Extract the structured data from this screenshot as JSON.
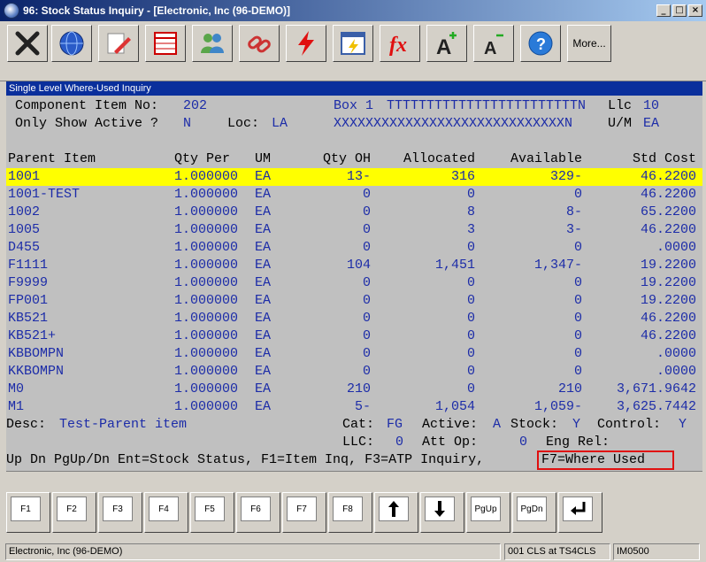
{
  "window": {
    "title": "96: Stock Status Inquiry - [Electronic, Inc (96-DEMO)]"
  },
  "toolbar": {
    "icons": [
      "close-x-icon",
      "globe-icon",
      "edit-pencil-icon",
      "spreadsheet-icon",
      "users-icon",
      "link-chain-icon",
      "lightning-icon",
      "calendar-lightning-icon",
      "function-fx-icon",
      "font-increase-icon",
      "font-decrease-icon",
      "help-icon"
    ],
    "more_label": "More..."
  },
  "panel": {
    "title": "Single Level Where-Used Inquiry"
  },
  "header": {
    "component_label": "Component Item No:",
    "component_value": "202",
    "box_label": "Box 1",
    "box_value": "TTTTTTTTTTTTTTTTTTTTTTTTN",
    "llc_label": "Llc",
    "llc_value": "10",
    "active_label": "Only Show Active ?",
    "active_value": "N",
    "loc_label": "Loc:",
    "loc_value": "LA",
    "desc_value": "XXXXXXXXXXXXXXXXXXXXXXXXXXXXXN",
    "um_label": "U/M",
    "um_value": "EA"
  },
  "table": {
    "columns": [
      "Parent Item",
      "Qty Per",
      "UM",
      "Qty OH",
      "Allocated",
      "Available",
      "Std Cost"
    ],
    "rows": [
      [
        "1001",
        "1.000000",
        "EA",
        "13-",
        "316",
        "329-",
        "46.2200"
      ],
      [
        "1001-TEST",
        "1.000000",
        "EA",
        "0",
        "0",
        "0",
        "46.2200"
      ],
      [
        "1002",
        "1.000000",
        "EA",
        "0",
        "8",
        "8-",
        "65.2200"
      ],
      [
        "1005",
        "1.000000",
        "EA",
        "0",
        "3",
        "3-",
        "46.2200"
      ],
      [
        "D455",
        "1.000000",
        "EA",
        "0",
        "0",
        "0",
        ".0000"
      ],
      [
        "F1111",
        "1.000000",
        "EA",
        "104",
        "1,451",
        "1,347-",
        "19.2200"
      ],
      [
        "F9999",
        "1.000000",
        "EA",
        "0",
        "0",
        "0",
        "19.2200"
      ],
      [
        "FP001",
        "1.000000",
        "EA",
        "0",
        "0",
        "0",
        "19.2200"
      ],
      [
        "KB521",
        "1.000000",
        "EA",
        "0",
        "0",
        "0",
        "46.2200"
      ],
      [
        "KB521+",
        "1.000000",
        "EA",
        "0",
        "0",
        "0",
        "46.2200"
      ],
      [
        "KBBOMPN",
        "1.000000",
        "EA",
        "0",
        "0",
        "0",
        ".0000"
      ],
      [
        "KKBOMPN",
        "1.000000",
        "EA",
        "0",
        "0",
        "0",
        ".0000"
      ],
      [
        "M0",
        "1.000000",
        "EA",
        "210",
        "0",
        "210",
        "3,671.9642"
      ],
      [
        "M1",
        "1.000000",
        "EA",
        "5-",
        "1,054",
        "1,059-",
        "3,625.7442"
      ]
    ],
    "selected_row": 0
  },
  "footer": {
    "desc_label": "Desc:",
    "desc_value": "Test-Parent item",
    "cat_label": "Cat:",
    "cat_value": "FG",
    "active_label": "Active:",
    "active_value": "A",
    "stock_label": "Stock:",
    "stock_value": "Y",
    "control_label": "Control:",
    "control_value": "Y",
    "llc_label": "LLC:",
    "llc_value": "0",
    "attop_label": "Att Op:",
    "attop_value": "0",
    "engrel_label": "Eng Rel:",
    "help_text": "Up Dn PgUp/Dn Ent=Stock Status, F1=Item Inq, F3=ATP Inquiry,",
    "help_f7": "F7=Where Used"
  },
  "fkeys": [
    "F1",
    "F2",
    "F3",
    "F4",
    "F5",
    "F6",
    "F7",
    "F8",
    "up-arrow-icon",
    "down-arrow-icon",
    "PgUp",
    "PgDn",
    "enter-icon"
  ],
  "statusbar": {
    "company": "Electronic, Inc (96-DEMO)",
    "session": "001 CLS at TS4CLS",
    "program": "IM0500"
  },
  "colors": {
    "selected_row": "#ffff00",
    "highlight_box": "#e01010",
    "text_blue": "#1c2ca8",
    "panel_title_bg": "#0a2f9c"
  }
}
